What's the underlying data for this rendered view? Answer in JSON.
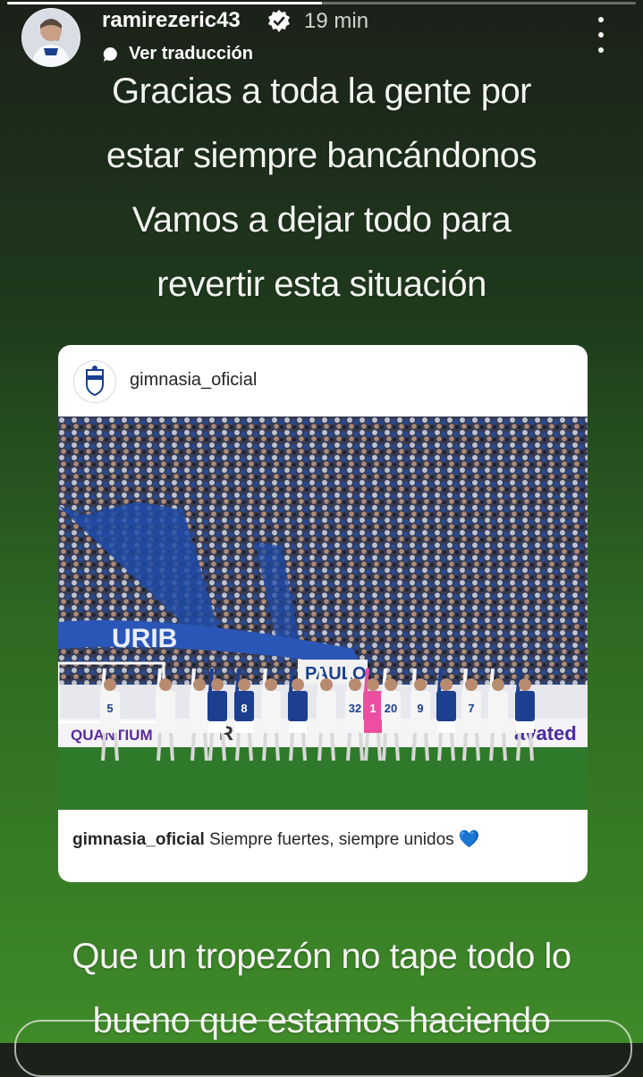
{
  "story": {
    "progress_fraction": 0.5,
    "username": "ramirezeric43",
    "timestamp": "19 min",
    "translate_label": "Ver traducción"
  },
  "caption_top": [
    "Gracias a toda la gente por",
    "estar siempre bancándonos",
    "Vamos a dejar todo para",
    "revertir esta situación"
  ],
  "shared_post": {
    "username": "gimnasia_oficial",
    "caption_user": "gimnasia_oficial",
    "caption_text": "Siempre fuertes, siempre unidos",
    "caption_emoji": "💙",
    "photo": {
      "banner_text": "URIB",
      "sign_text": "PAULO",
      "board_left": "QUANTIUM",
      "board_mid": "R",
      "board_right": "avated",
      "jersey_numbers": [
        "5",
        "8",
        "1",
        "20",
        "9",
        "7",
        "32"
      ]
    }
  },
  "caption_bottom": [
    "Que un tropezón no tape todo lo",
    "bueno que estamos haciendo"
  ],
  "colors": {
    "verified": "#3897f0",
    "heart": "#1f6fd8",
    "pitch": "#2f7a2a"
  },
  "icons": {
    "verified": "verified-badge-icon",
    "more": "more-options-icon",
    "translate": "speech-bubble-icon"
  }
}
